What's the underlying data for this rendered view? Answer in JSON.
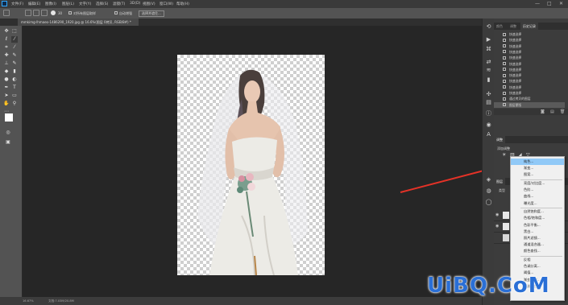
{
  "menubar": {
    "items": [
      "文件(F)",
      "编辑(E)",
      "图像(I)",
      "图层(L)",
      "文字(Y)",
      "选择(S)",
      "滤镜(T)",
      "3D(D)",
      "视图(V)",
      "窗口(W)",
      "帮助(H)"
    ],
    "win_controls": [
      "—",
      "□",
      "✕"
    ]
  },
  "optionsbar": {
    "brush_size": "30",
    "sample_all_layers": "对所有图层取样",
    "auto_enhance": "自动增强",
    "refine_edge": "选择并遮住..."
  },
  "document_tab": {
    "label": "mmkimg-lhmaeo-1486290_1920.jpg @ 16.6%(图层 0拷贝, RGB/8#) *"
  },
  "statusbar": {
    "zoom": "16.67%",
    "doc_info": "文档:7.03M/20.8M"
  },
  "history_panel": {
    "tabs": [
      "调整",
      "历史记录"
    ],
    "active_tab": "历史记录",
    "extra_tab": "颜色",
    "rows": [
      "快速选择",
      "快速选择",
      "快速选择",
      "快速选择",
      "快速选择",
      "快速选择",
      "快速选择",
      "快速选择",
      "快速选择",
      "快速选择",
      "快速选择",
      "通过拷贝的图层",
      "图层蒙版"
    ]
  },
  "adjust_panel": {
    "title": "调整",
    "subtitle": "添加调整"
  },
  "layers_panel": {
    "tab": "图层",
    "kind_label": "类型"
  },
  "adjust_menu": {
    "items": [
      "纯色...",
      "渐变...",
      "图案...",
      "---",
      "亮度/对比度...",
      "色阶...",
      "曲线...",
      "曝光度...",
      "---",
      "自然饱和度...",
      "色相/饱和度...",
      "色彩平衡...",
      "黑白...",
      "照片滤镜...",
      "通道混合器...",
      "颜色查找...",
      "---",
      "反相",
      "色调分离...",
      "阈值...",
      "渐变映射...",
      "可选颜色..."
    ],
    "highlighted_index": 0
  },
  "annotation": {
    "arrow_color": "#e53227"
  },
  "watermark": {
    "text": "UiBQ.CoM"
  },
  "colors": {
    "accent_blue": "#31a8ff",
    "highlight": "#91c9f7"
  }
}
